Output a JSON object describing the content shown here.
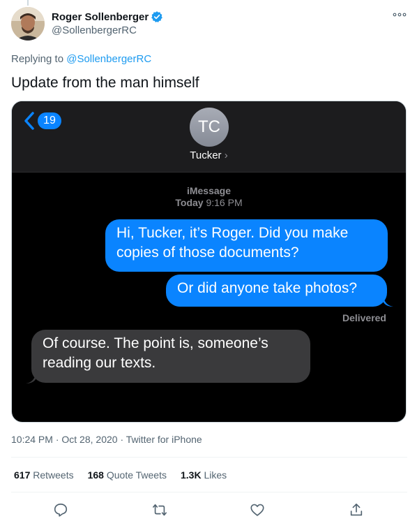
{
  "author": {
    "name": "Roger Sollenberger",
    "handle": "@SollenbergerRC",
    "verified": true
  },
  "replying": {
    "prefix": "Replying to",
    "to": "@SollenbergerRC"
  },
  "tweet": {
    "text": "Update from the man himself"
  },
  "screenshot": {
    "back_count": "19",
    "contact_initials": "TC",
    "contact_name": "Tucker",
    "service": "iMessage",
    "day": "Today",
    "time": "9:16 PM",
    "messages": [
      {
        "direction": "out",
        "text": "Hi, Tucker, it’s Roger. Did you make copies of those documents?"
      },
      {
        "direction": "out",
        "text": "Or did anyone take photos?"
      },
      {
        "direction": "in",
        "text": "Of course. The point is, someone’s reading our texts."
      }
    ],
    "status": "Delivered"
  },
  "meta": {
    "time": "10:24 PM",
    "date": "Oct 28, 2020",
    "source": "Twitter for iPhone",
    "separator": "·"
  },
  "stats": {
    "retweets": "617",
    "retweets_label": "Retweets",
    "quotes": "168",
    "quotes_label": "Quote Tweets",
    "likes": "1.3K",
    "likes_label": "Likes"
  },
  "colors": {
    "twitter_blue": "#1d9bf0",
    "imessage_blue": "#0a84ff",
    "incoming_gray": "#3a3a3c"
  },
  "icons": [
    "verified-icon",
    "more-icon",
    "back-chevron-icon",
    "reply-icon",
    "retweet-icon",
    "like-icon",
    "share-icon"
  ]
}
